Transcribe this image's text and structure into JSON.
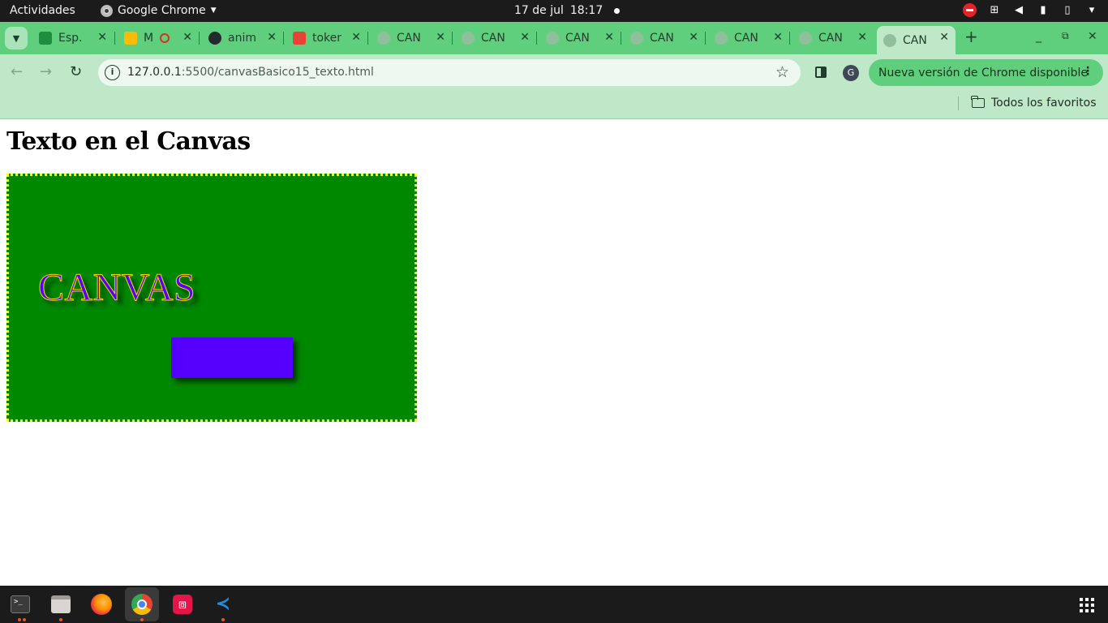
{
  "system_bar": {
    "activities": "Actividades",
    "app_name": "Google Chrome",
    "date": "17 de jul",
    "time": "18:17"
  },
  "tabs": [
    {
      "title": "Esp.",
      "icon": "contacts-icon",
      "color": "#1e8e3e"
    },
    {
      "title": "M",
      "icon": "drive-icon",
      "color": "#fbbc05"
    },
    {
      "title": "anim",
      "icon": "github-icon",
      "color": "#24292e"
    },
    {
      "title": "token",
      "icon": "gmail-icon",
      "color": "#ea4335"
    },
    {
      "title": "CAN",
      "icon": "globe-icon",
      "color": "#8fbf9b"
    },
    {
      "title": "CAN",
      "icon": "globe-icon",
      "color": "#8fbf9b"
    },
    {
      "title": "CAN",
      "icon": "globe-icon",
      "color": "#8fbf9b"
    },
    {
      "title": "CAN",
      "icon": "globe-icon",
      "color": "#8fbf9b"
    },
    {
      "title": "CAN",
      "icon": "globe-icon",
      "color": "#8fbf9b"
    },
    {
      "title": "CAN",
      "icon": "globe-icon",
      "color": "#8fbf9b"
    },
    {
      "title": "CAN",
      "icon": "globe-icon",
      "color": "#8fbf9b",
      "active": true
    }
  ],
  "address_bar": {
    "host": "127.0.0.1",
    "path": ":5500/canvasBasico15_texto.html"
  },
  "profile_initial": "G",
  "update_button": "Nueva versión de Chrome disponible",
  "bookmarks": {
    "all_bookmarks": "Todos los favoritos"
  },
  "page": {
    "heading": "Texto en el Canvas",
    "canvas_text": "CANVAS"
  },
  "colors": {
    "browser_accent": "#5fcf7d",
    "toolbar_bg": "#bfe8c9",
    "canvas_bg": "#008800",
    "canvas_border": "#ffff00",
    "canvas_text_fill": "#5500ff",
    "canvas_text_stroke": "#ffd400",
    "rect_fill": "#5500ff"
  },
  "dock": [
    {
      "name": "terminal-icon",
      "running": true
    },
    {
      "name": "files-icon",
      "running": true
    },
    {
      "name": "firefox-icon",
      "running": false
    },
    {
      "name": "chrome-icon",
      "running": true,
      "active": true
    },
    {
      "name": "screenshot-crop-icon",
      "running": false
    },
    {
      "name": "vscode-icon",
      "running": true
    }
  ]
}
